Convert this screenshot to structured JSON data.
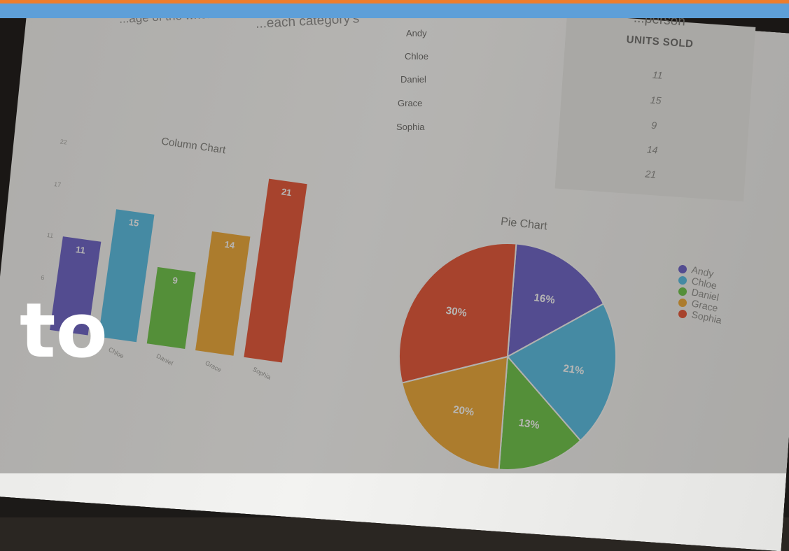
{
  "banner": {
    "accent": "#ef7d2b",
    "band_color": "#5e9fd8"
  },
  "intro": {
    "line1": "...each category's",
    "line2": "...age of the whole."
  },
  "table": {
    "header_right": "...person",
    "units_header": "UNITS SOLD",
    "names": [
      "Andy",
      "Chloe",
      "Daniel",
      "Grace",
      "Sophia"
    ],
    "units": [
      "11",
      "15",
      "9",
      "14",
      "21"
    ]
  },
  "overlay_word": "to",
  "chart_data": [
    {
      "type": "bar",
      "title": "Column Chart",
      "categories": [
        "Andy",
        "Chloe",
        "Daniel",
        "Grace",
        "Sophia"
      ],
      "values": [
        11,
        15,
        9,
        14,
        21
      ],
      "ytick_labels": [
        "22",
        "17",
        "11",
        "6"
      ],
      "ylim": [
        0,
        22
      ],
      "colors": [
        "#6b63c2",
        "#58b9dd",
        "#6cbf4a",
        "#e7a63a",
        "#e0573a"
      ],
      "grid": false
    },
    {
      "type": "pie",
      "title": "Pie Chart",
      "labels": [
        "Andy",
        "Chloe",
        "Daniel",
        "Grace",
        "Sophia"
      ],
      "values": [
        16,
        21,
        13,
        20,
        30
      ],
      "value_labels": [
        "16%",
        "21%",
        "13%",
        "20%",
        "30%"
      ],
      "colors": [
        "#6b63c2",
        "#58b9dd",
        "#6cbf4a",
        "#e7a63a",
        "#e0573a"
      ],
      "legend": "right"
    }
  ]
}
